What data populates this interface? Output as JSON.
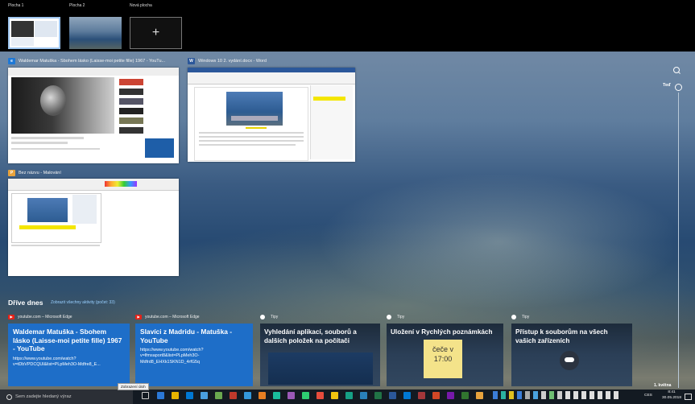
{
  "desktops": [
    {
      "label": "Plocha 1",
      "active": true
    },
    {
      "label": "Plocha 2",
      "active": false
    },
    {
      "label": "Nová plocha",
      "active": false
    }
  ],
  "windows": [
    {
      "title": "Waldemar Matuška - Sbohem lásko (Laisse-moi petite fille) 1967 - YouTu...",
      "app_icon": "edge-icon"
    },
    {
      "title": "Windows 10 2. vydání.docx - Word",
      "app_icon": "word-icon"
    },
    {
      "title": "Bez názvu - Malování",
      "app_icon": "paint-icon"
    }
  ],
  "search_icon": "magnifier-icon",
  "timeline": {
    "now_label": "Teď",
    "date_label": "1. května"
  },
  "earlier": {
    "title": "Dříve dnes",
    "link": "Zobrazit všechny aktivity (počet: 33)"
  },
  "cards": [
    {
      "source": "youtube.com – Microsoft Edge",
      "title": "Waldemar Matuška - Sbohem lásko (Laisse-moi petite fille) 1967 - YouTube",
      "url": "https://www.youtube.com/watch?v=tDbVPDCQUl&list=PLpMeh3O-Mdfre8_E..."
    },
    {
      "source": "youtube.com – Microsoft Edge",
      "title": "Slavíci z Madridu - Matuška - YouTube",
      "url": "https://www.youtube.com/watch?v=lfmsaport8&list=PLpMeh3O-Mdfrd8_EHXk1SKN1D_4rfG5q"
    },
    {
      "source": "Tipy",
      "title": "Vyhledání aplikací, souborů a dalších položek na počítači"
    },
    {
      "source": "Tipy",
      "title": "Uložení v Rychlých poznámkách",
      "note_text": "čeče v 17:00"
    },
    {
      "source": "Tipy",
      "title": "Přístup k souborům na všech vašich zařízeních"
    }
  ],
  "taskbar": {
    "search_placeholder": "Sem zadejte hledaný výraz",
    "tooltip": "Zobrazení úloh",
    "lang": "CES",
    "time": "8:41",
    "date": "30.05.2018"
  },
  "colors": {
    "accent_blue": "#1e6ec8",
    "taskbar": "#131a22",
    "link": "#9ad0ff"
  }
}
